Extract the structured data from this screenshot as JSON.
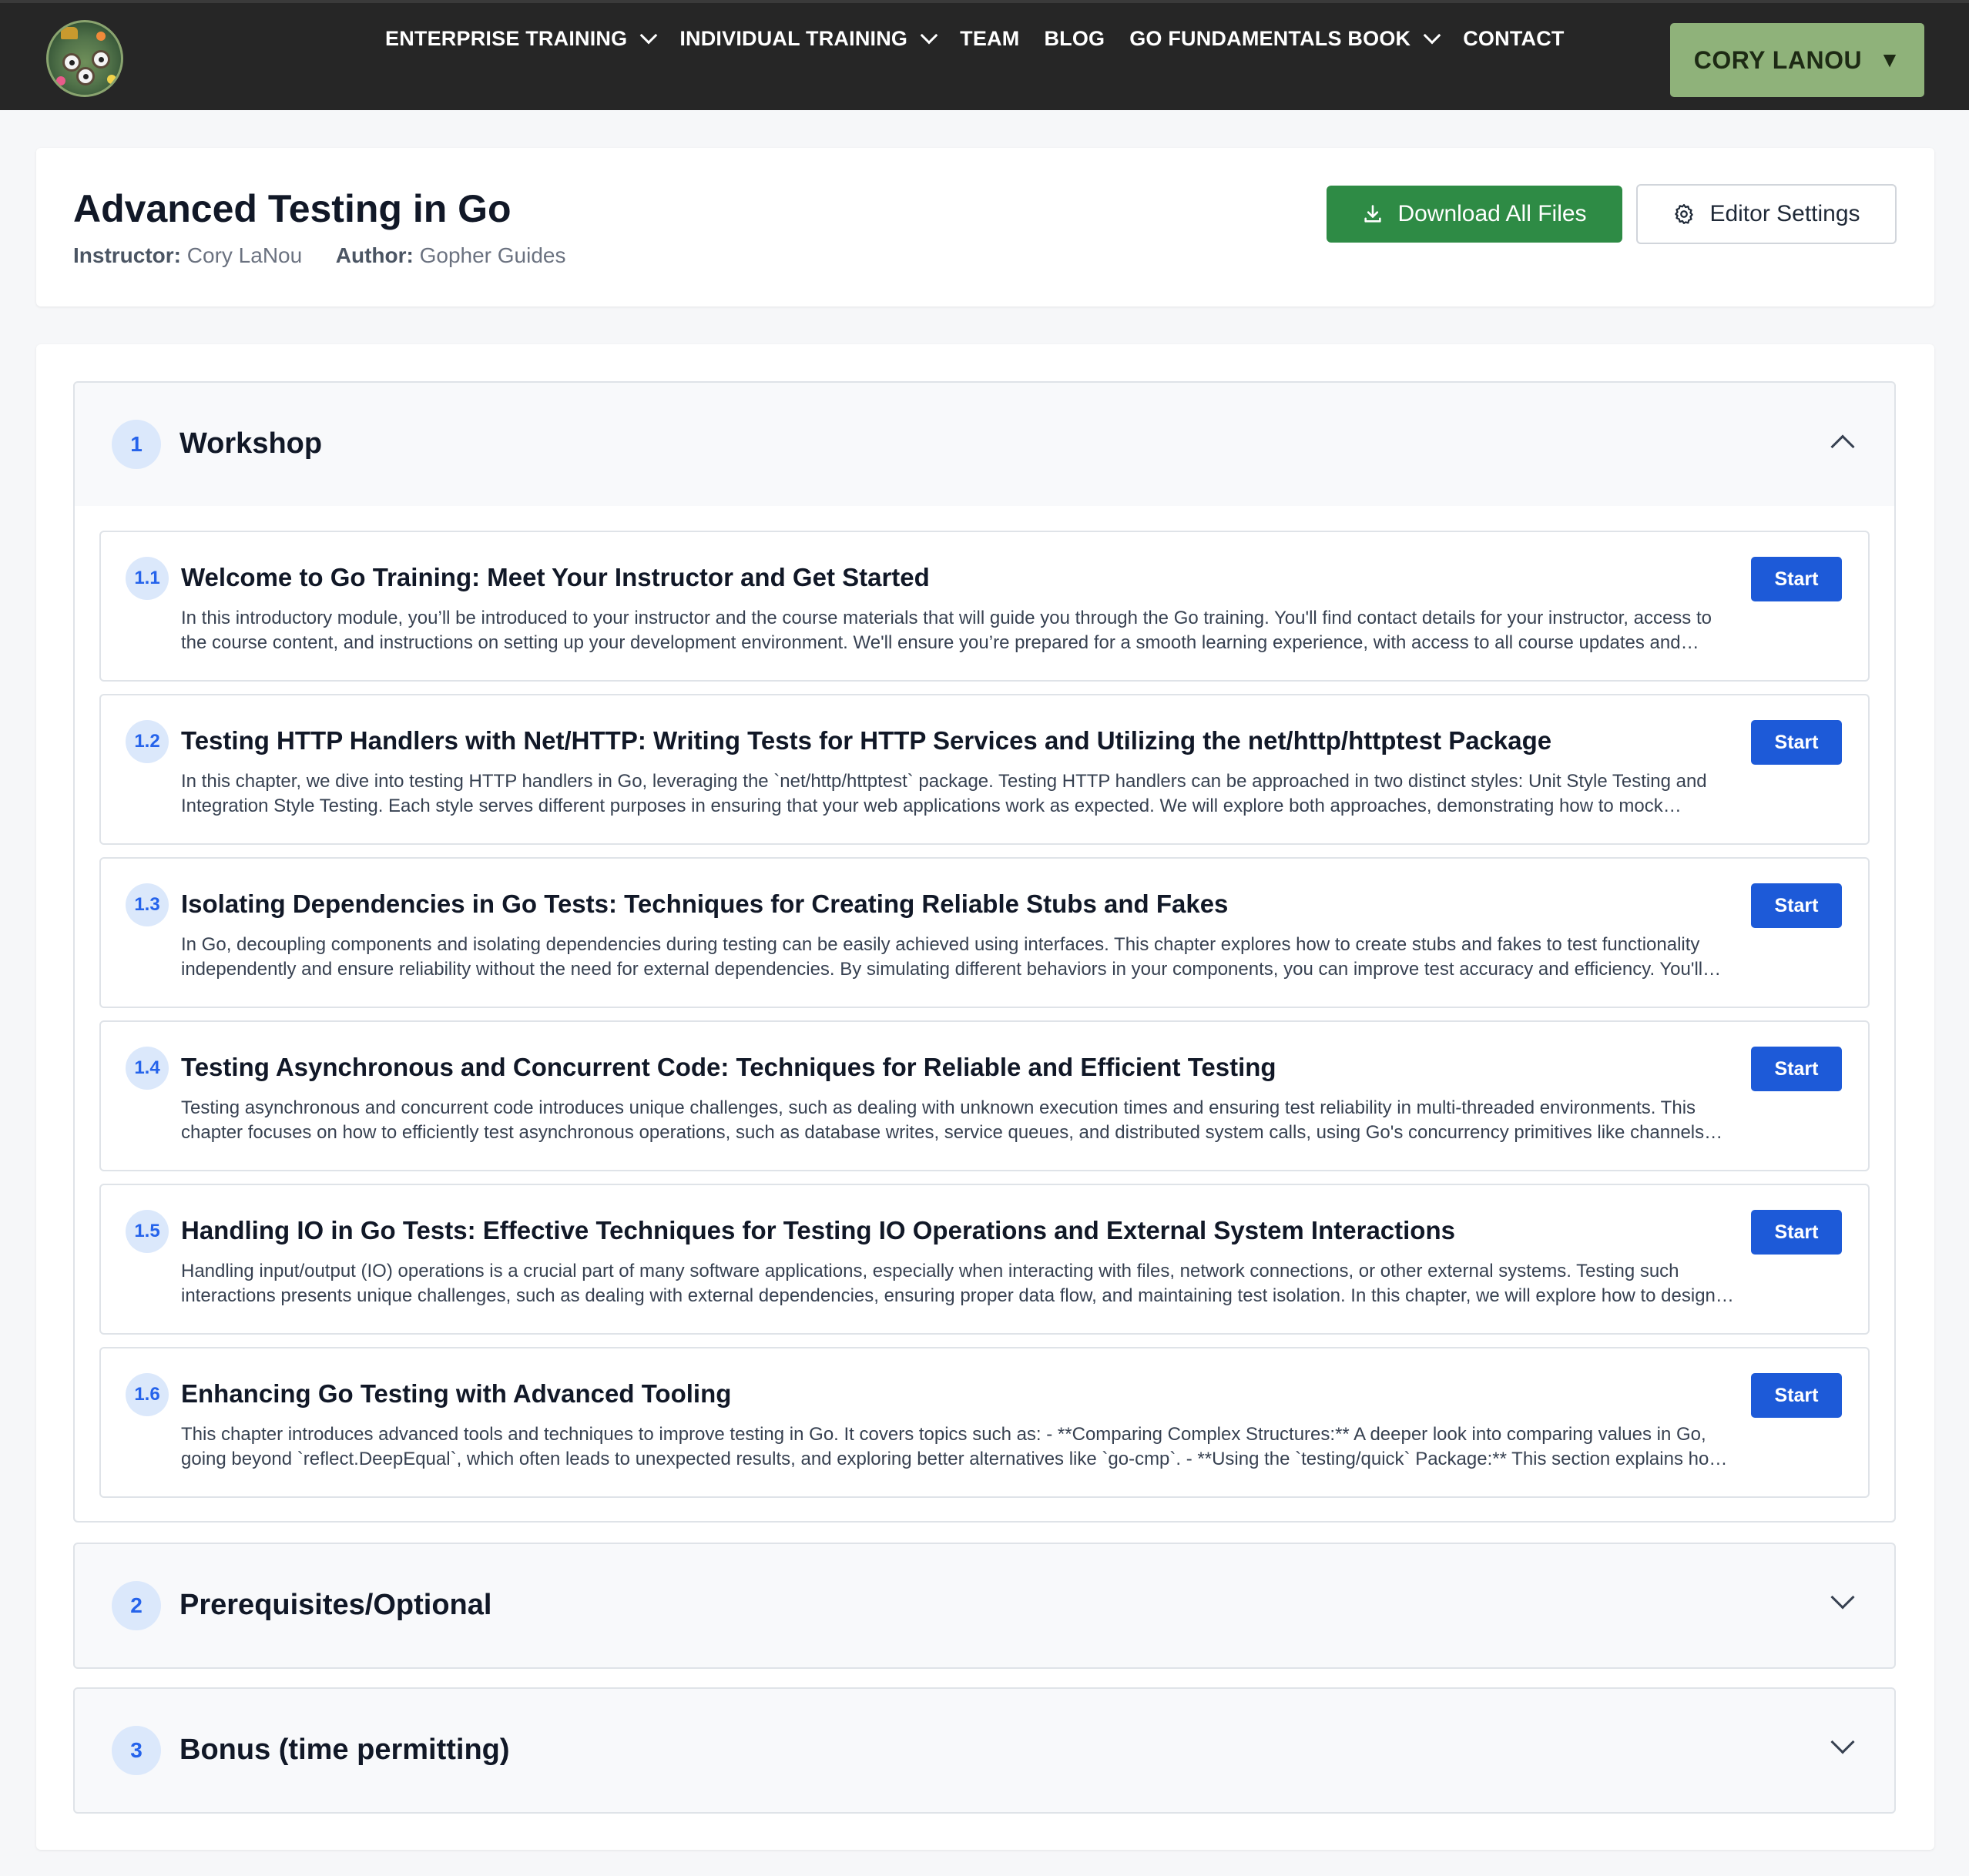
{
  "nav": {
    "items": [
      {
        "label": "ENTERPRISE TRAINING",
        "dropdown": true
      },
      {
        "label": "INDIVIDUAL TRAINING",
        "dropdown": true
      },
      {
        "label": "TEAM",
        "dropdown": false
      },
      {
        "label": "BLOG",
        "dropdown": false
      },
      {
        "label": "GO FUNDAMENTALS BOOK",
        "dropdown": true
      },
      {
        "label": "CONTACT",
        "dropdown": false
      }
    ],
    "user_label": "CORY LANOU",
    "user_caret": "▼"
  },
  "course": {
    "title": "Advanced Testing in Go",
    "instructor_label": "Instructor:",
    "instructor": "Cory LaNou",
    "author_label": "Author:",
    "author": "Gopher Guides",
    "download_label": "Download All Files",
    "settings_label": "Editor Settings"
  },
  "sections": [
    {
      "number": "1",
      "title": "Workshop",
      "expanded": true,
      "lessons": [
        {
          "number": "1.1",
          "title": "Welcome to Go Training: Meet Your Instructor and Get Started",
          "description": "In this introductory module, you’ll be introduced to your instructor and the course materials that will guide you through the Go training. You'll find contact details for your instructor, access to the course content, and instructions on setting up your development environment. We'll ensure you’re prepared for a smooth learning experience, with access to all course updates and resources.",
          "button": "Start"
        },
        {
          "number": "1.2",
          "title": "Testing HTTP Handlers with Net/HTTP: Writing Tests for HTTP Services and Utilizing the net/http/httptest Package",
          "description": "In this chapter, we dive into testing HTTP handlers in Go, leveraging the `net/http/httptest` package. Testing HTTP handlers can be approached in two distinct styles: Unit Style Testing and Integration Style Testing. Each style serves different purposes in ensuring that your web applications work as expected. We will explore both approaches, demonstrating how to mock requests and responses.",
          "button": "Start"
        },
        {
          "number": "1.3",
          "title": "Isolating Dependencies in Go Tests: Techniques for Creating Reliable Stubs and Fakes",
          "description": "In Go, decoupling components and isolating dependencies during testing can be easily achieved using interfaces. This chapter explores how to create stubs and fakes to test functionality independently and ensure reliability without the need for external dependencies. By simulating different behaviors in your components, you can improve test accuracy and efficiency. You'll learn more.",
          "button": "Start"
        },
        {
          "number": "1.4",
          "title": "Testing Asynchronous and Concurrent Code: Techniques for Reliable and Efficient Testing",
          "description": "Testing asynchronous and concurrent code introduces unique challenges, such as dealing with unknown execution times and ensuring test reliability in multi-threaded environments. This chapter focuses on how to efficiently test asynchronous operations, such as database writes, service queues, and distributed system calls, using Go's concurrency primitives like channels and contexts.",
          "button": "Start"
        },
        {
          "number": "1.5",
          "title": "Handling IO in Go Tests: Effective Techniques for Testing IO Operations and External System Interactions",
          "description": "Handling input/output (IO) operations is a crucial part of many software applications, especially when interacting with files, network connections, or other external systems. Testing such interactions presents unique challenges, such as dealing with external dependencies, ensuring proper data flow, and maintaining test isolation. In this chapter, we will explore how to design tests.",
          "button": "Start"
        },
        {
          "number": "1.6",
          "title": "Enhancing Go Testing with Advanced Tooling",
          "description": "This chapter introduces advanced tools and techniques to improve testing in Go. It covers topics such as: - **Comparing Complex Structures:** A deeper look into comparing values in Go, going beyond `reflect.DeepEqual`, which often leads to unexpected results, and exploring better alternatives like `go-cmp`. - **Using the `testing/quick` Package:** This section explains how to use it.",
          "button": "Start"
        }
      ]
    },
    {
      "number": "2",
      "title": "Prerequisites/Optional",
      "expanded": false
    },
    {
      "number": "3",
      "title": "Bonus (time permitting)",
      "expanded": false
    }
  ],
  "colors": {
    "nav_bg": "#262626",
    "user_button": "#8fb27a",
    "download_button": "#2e8b45",
    "start_button": "#1d5ad8",
    "badge_bg": "#dbe8fb",
    "badge_text": "#2563eb"
  },
  "icons": {
    "logo": "gopher-logo-icon",
    "download": "download-icon",
    "settings": "gear-icon",
    "nav_dropdown": "chevron-down-icon",
    "section_expanded": "chevron-up-icon",
    "section_collapsed": "chevron-down-icon"
  }
}
